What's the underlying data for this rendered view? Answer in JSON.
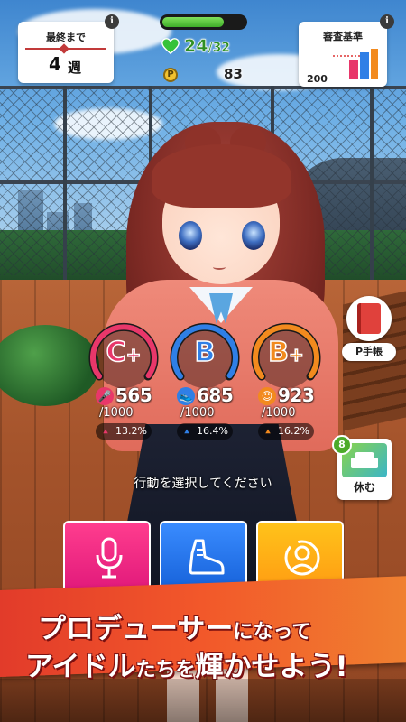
{
  "deadline": {
    "title": "最終まで",
    "weeks": "4",
    "unit": "週"
  },
  "stamina": {
    "current": "24",
    "max": "/32",
    "fraction": 0.75,
    "color": "#3fae2a"
  },
  "points": {
    "symbol": "P",
    "amount": "83"
  },
  "audition": {
    "title": "審査基準",
    "value": "200"
  },
  "info_glyph": "i",
  "stats": [
    {
      "key": "vocal",
      "grade": "C",
      "plus": "+",
      "value": "565",
      "max": "/1000",
      "percent": "13.2%",
      "color": "#e8376a",
      "icon": "microphone-icon",
      "icon_glyph": "🎤"
    },
    {
      "key": "dance",
      "grade": "B",
      "plus": "",
      "value": "685",
      "max": "/1000",
      "percent": "16.4%",
      "color": "#2f7fe6",
      "icon": "shoe-icon",
      "icon_glyph": "👟"
    },
    {
      "key": "visual",
      "grade": "B",
      "plus": "+",
      "value": "923",
      "max": "/1000",
      "percent": "16.2%",
      "color": "#f28a1e",
      "icon": "visual-icon",
      "icon_glyph": "☺"
    }
  ],
  "side": {
    "pbook_label": "P手帳",
    "rest_label": "休む",
    "rest_badge": "8"
  },
  "prompt": "行動を選択してください",
  "actions": [
    {
      "name": "vocal-lesson",
      "icon": "microphone-icon",
      "color_top": "#ff3d8e",
      "color_bottom": "#e0187a"
    },
    {
      "name": "dance-lesson",
      "icon": "shoe-icon",
      "color_top": "#3a8cff",
      "color_bottom": "#1560d8"
    },
    {
      "name": "visual-lesson",
      "icon": "visual-icon",
      "color_top": "#ffc31a",
      "color_bottom": "#ff9a12"
    }
  ],
  "banner": {
    "line1_big": "プロデューサー",
    "line1_small": "になって",
    "line2_big": "アイドル",
    "line2_small": "たちを",
    "line2_big2": "輝かせよう!"
  }
}
